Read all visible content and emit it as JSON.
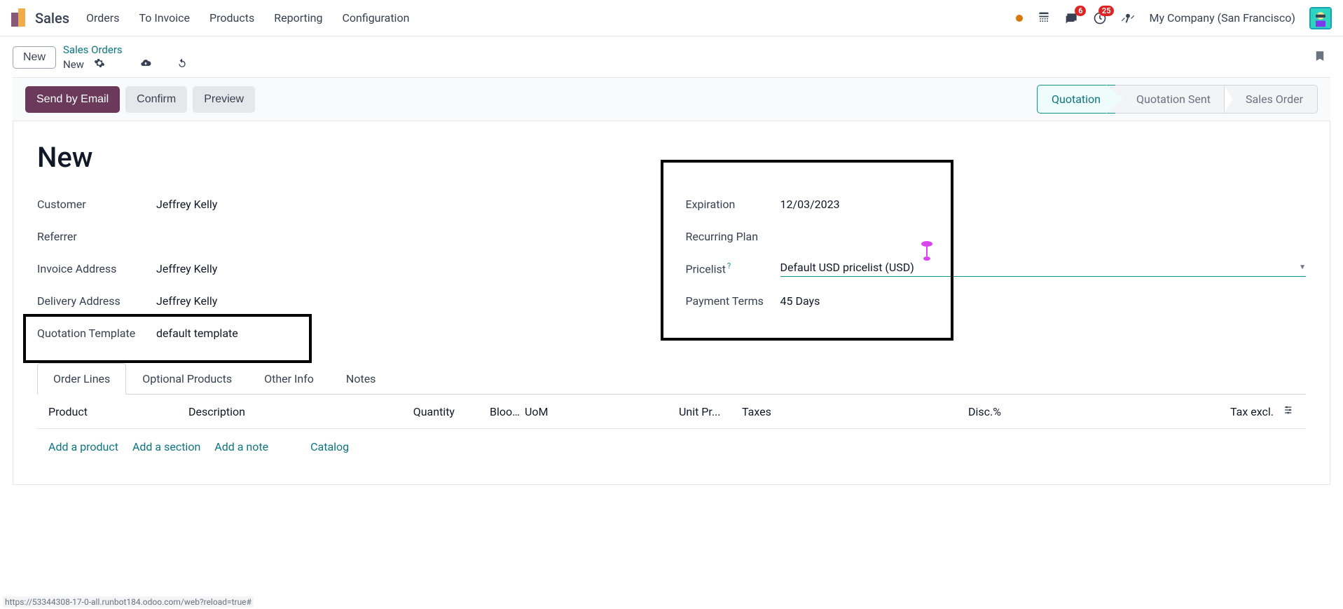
{
  "topnav": {
    "brand": "Sales",
    "menu": [
      "Orders",
      "To Invoice",
      "Products",
      "Reporting",
      "Configuration"
    ],
    "messages_badge": "6",
    "activities_badge": "25",
    "company": "My Company (San Francisco)"
  },
  "breadcrumb": {
    "new_button": "New",
    "parent": "Sales Orders",
    "current": "New"
  },
  "actions": {
    "send_email": "Send by Email",
    "confirm": "Confirm",
    "preview": "Preview"
  },
  "status": {
    "quotation": "Quotation",
    "quotation_sent": "Quotation Sent",
    "sales_order": "Sales Order"
  },
  "form": {
    "title": "New",
    "left": {
      "customer_label": "Customer",
      "customer_value": "Jeffrey Kelly",
      "referrer_label": "Referrer",
      "referrer_value": "",
      "invoice_addr_label": "Invoice Address",
      "invoice_addr_value": "Jeffrey Kelly",
      "delivery_addr_label": "Delivery Address",
      "delivery_addr_value": "Jeffrey Kelly",
      "template_label": "Quotation Template",
      "template_value": "default template"
    },
    "right": {
      "expiration_label": "Expiration",
      "expiration_value": "12/03/2023",
      "recurring_label": "Recurring Plan",
      "recurring_value": "",
      "pricelist_label": "Pricelist",
      "pricelist_value": "Default USD pricelist (USD)",
      "payment_label": "Payment Terms",
      "payment_value": "45 Days"
    }
  },
  "tabs": {
    "order_lines": "Order Lines",
    "optional": "Optional Products",
    "other": "Other Info",
    "notes": "Notes"
  },
  "grid": {
    "headers": {
      "product": "Product",
      "description": "Description",
      "quantity": "Quantity",
      "blood": "Blood A...",
      "uom": "UoM",
      "unit_price": "Unit Pr...",
      "taxes": "Taxes",
      "disc": "Disc.%",
      "tax_excl": "Tax excl."
    },
    "actions": {
      "add_product": "Add a product",
      "add_section": "Add a section",
      "add_note": "Add a note",
      "catalog": "Catalog"
    }
  },
  "footer_url": "https://53344308-17-0-all.runbot184.odoo.com/web?reload=true#"
}
